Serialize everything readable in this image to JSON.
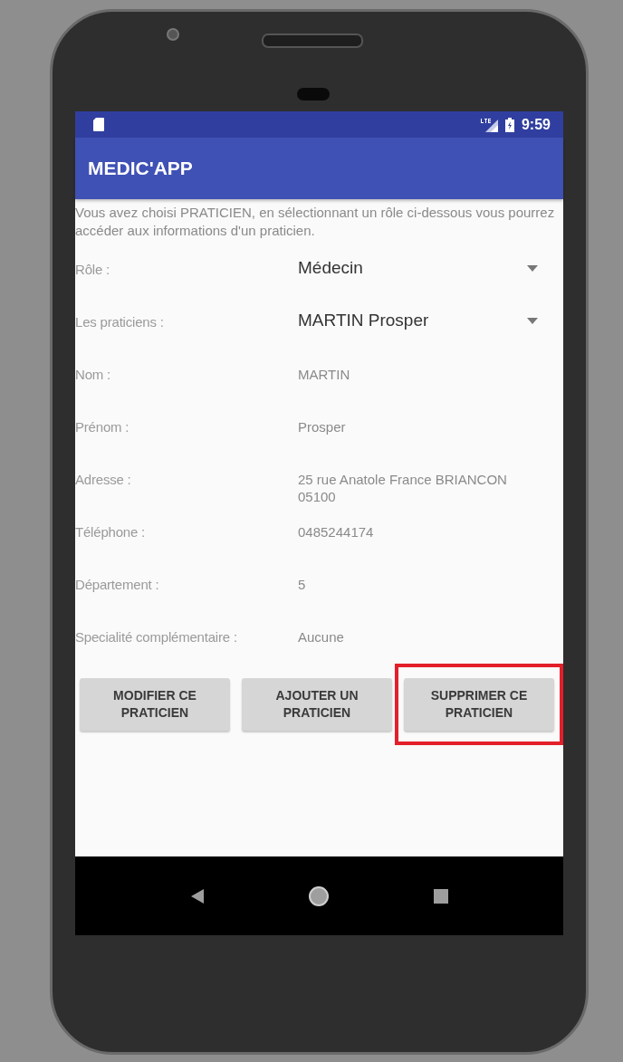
{
  "status_bar": {
    "time": "9:59"
  },
  "app_bar": {
    "title": "MEDIC'APP"
  },
  "intro": "Vous avez choisi PRATICIEN, en sélectionnant un rôle ci-dessous vous pourrez accéder aux informations d'un praticien.",
  "fields": [
    {
      "kind": "spinner",
      "label": "Rôle :",
      "value": "Médecin"
    },
    {
      "kind": "spinner",
      "label": "Les praticiens :",
      "value": "MARTIN Prosper"
    },
    {
      "kind": "text",
      "label": "Nom :",
      "value": "MARTIN"
    },
    {
      "kind": "text",
      "label": "Prénom :",
      "value": "Prosper"
    },
    {
      "kind": "text",
      "label": "Adresse :",
      "value": "25 rue Anatole France BRIANCON 05100"
    },
    {
      "kind": "text",
      "label": "Téléphone :",
      "value": "0485244174"
    },
    {
      "kind": "text",
      "label": "Département :",
      "value": "5"
    },
    {
      "kind": "text",
      "label": "Specialité complémentaire :",
      "value": "Aucune"
    }
  ],
  "buttons": [
    {
      "label": "MODIFIER CE PRATICIEN",
      "highlighted": false
    },
    {
      "label": "AJOUTER UN PRATICIEN",
      "highlighted": false
    },
    {
      "label": "SUPPRIMER CE PRATICIEN",
      "highlighted": true
    }
  ]
}
